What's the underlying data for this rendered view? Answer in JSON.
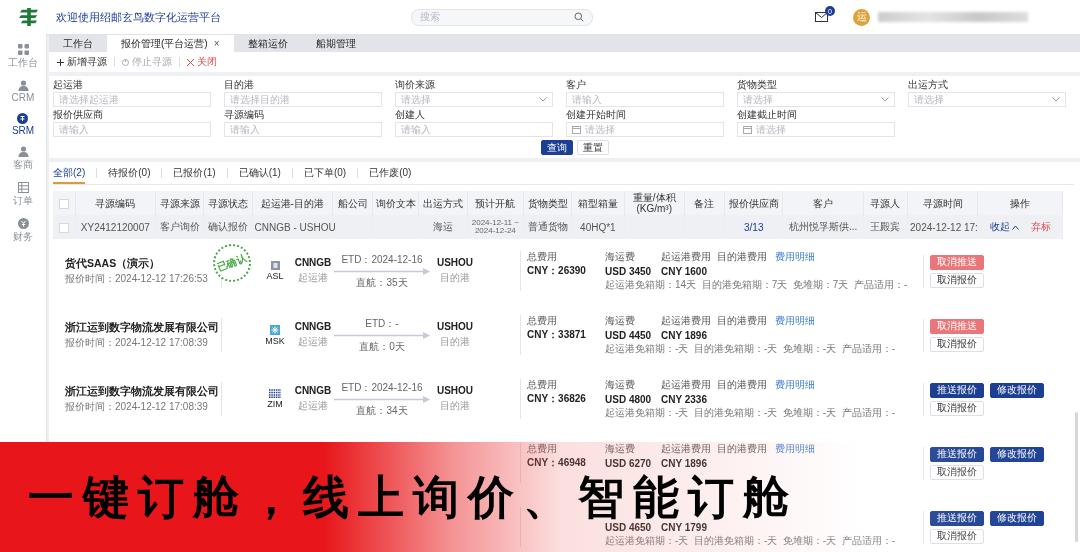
{
  "header": {
    "title": "欢迎使用绍邮玄鸟数字化运营平台",
    "search": {
      "placeholder": "搜索"
    },
    "mail_badge": "0",
    "avatar": "运"
  },
  "sidebar": {
    "items": [
      {
        "label": "工作台",
        "selected": false
      },
      {
        "label": "CRM",
        "selected": false
      },
      {
        "label": "SRM",
        "selected": true
      },
      {
        "label": "客商",
        "selected": false
      },
      {
        "label": "订单",
        "selected": false
      },
      {
        "label": "财务",
        "selected": false
      }
    ]
  },
  "tabs": [
    {
      "label": "工作台",
      "selected": false
    },
    {
      "label": "报价管理(平台运营)",
      "selected": true,
      "close": "×"
    },
    {
      "label": "整箱运价",
      "selected": false
    },
    {
      "label": "船期管理",
      "selected": false
    }
  ],
  "toolbar": [
    {
      "kind": "add",
      "label": "新增寻源",
      "disabled": false
    },
    {
      "kind": "stop",
      "label": "停止寻源",
      "disabled": true
    },
    {
      "kind": "close",
      "label": "关闭",
      "disabled": false
    }
  ],
  "filters": [
    {
      "label": "起运港",
      "kind": "text",
      "placeholder": "请选择起运港"
    },
    {
      "label": "目的港",
      "kind": "text",
      "placeholder": "请选择目的港"
    },
    {
      "label": "询价来源",
      "kind": "select",
      "placeholder": "请选择"
    },
    {
      "label": "客户",
      "kind": "text",
      "placeholder": "请输入"
    },
    {
      "label": "货物类型",
      "kind": "select",
      "placeholder": "请选择"
    },
    {
      "label": "出运方式",
      "kind": "select",
      "placeholder": "请选择"
    },
    {
      "label": "报价供应商",
      "kind": "text",
      "placeholder": "请输入"
    },
    {
      "label": "寻源编码",
      "kind": "text",
      "placeholder": "请输入"
    },
    {
      "label": "创建人",
      "kind": "text",
      "placeholder": "请输入"
    },
    {
      "label": "创建开始时间",
      "kind": "date",
      "placeholder": "请选择"
    },
    {
      "label": "创建截止时间",
      "kind": "date",
      "placeholder": "请选择"
    }
  ],
  "filter_buttons": [
    {
      "label": "查询",
      "kind": "primary"
    },
    {
      "label": "重置",
      "kind": "plain"
    }
  ],
  "status_tabs": [
    {
      "label": "全部(2)",
      "selected": true
    },
    {
      "label": "待报价(0)",
      "selected": false
    },
    {
      "label": "已报价(1)",
      "selected": false
    },
    {
      "label": "已确认(1)",
      "selected": false
    },
    {
      "label": "已下单(0)",
      "selected": false
    },
    {
      "label": "已作废(0)",
      "selected": false
    }
  ],
  "table": {
    "all_checked": false,
    "columns": [
      "寻源编码",
      "寻源来源",
      "寻源状态",
      "起运港-目的港",
      "船公司",
      "询价文本",
      "出运方式",
      "预计开航",
      "货物类型",
      "箱型箱量",
      "重量/体积(KG/m³)",
      "备注",
      "报价供应商",
      "客户",
      "寻源人",
      "寻源时间",
      "操作"
    ],
    "rows": [
      {
        "checked": false,
        "expanded": true,
        "cells": [
          "XY2412120007",
          "客户询价",
          "确认报价",
          "CNNGB - USHOU",
          null,
          null,
          "海运",
          "2024-12-11 ~ 2024-12-24",
          "普通货物",
          "40HQ*1",
          null,
          null,
          "3/13",
          "杭州悦孚斯供...",
          "王殿宾",
          "2024-12-12 17:"
        ],
        "actions": [
          {
            "label": "收起",
            "kind": "collapse"
          },
          {
            "label": "弃标",
            "kind": "danger"
          }
        ]
      }
    ]
  },
  "quotes": [
    {
      "company": "货代SAAS（演示）",
      "time": "报价时间：2024-12-12 17:26:53",
      "stamp": "已确认",
      "carrier": "ASL",
      "origin": "CNNGB",
      "origin_label": "起运港",
      "etd": "ETD：2024-12-16",
      "transit": "直航：35天",
      "dest": "USHOU",
      "dest_label": "目的港",
      "total_label": "总费用",
      "total": "CNY：26390",
      "fee_labels": [
        "海运费",
        "起运港费用",
        "目的港费用"
      ],
      "fee_values": [
        "USD 3450",
        "CNY 1600"
      ],
      "detail_link": "费用明细",
      "terms": "起运港免箱期：14天  目的港免箱期：7天  免堆期：7天  产品适用：-",
      "action_rows": [
        [
          {
            "label": "取消推送",
            "kind": "danger"
          }
        ],
        [
          {
            "label": "取消报价",
            "kind": "plain"
          }
        ]
      ]
    },
    {
      "company": "浙江运到数字物流发展有限公司",
      "time": "报价时间：2024-12-12 17:08:39",
      "carrier": "MSK",
      "origin": "CNNGB",
      "origin_label": "起运港",
      "etd": "ETD：-",
      "transit": "直航：0天",
      "dest": "USHOU",
      "dest_label": "目的港",
      "total_label": "总费用",
      "total": "CNY：33871",
      "fee_labels": [
        "海运费",
        "起运港费用",
        "目的港费用"
      ],
      "fee_values": [
        "USD 4450",
        "CNY 1896"
      ],
      "detail_link": "费用明细",
      "terms": "起运港免箱期：-天  目的港免箱期：-天  免堆期：-天  产品适用：-",
      "action_rows": [
        [
          {
            "label": "取消推送",
            "kind": "danger"
          }
        ],
        [
          {
            "label": "取消报价",
            "kind": "plain"
          }
        ]
      ]
    },
    {
      "company": "浙江运到数字物流发展有限公司",
      "time": "报价时间：2024-12-12 17:08:39",
      "carrier": "ZIM",
      "origin": "CNNGB",
      "origin_label": "起运港",
      "etd": "ETD：2024-12-16",
      "transit": "直航：34天",
      "dest": "USHOU",
      "dest_label": "目的港",
      "total_label": "总费用",
      "total": "CNY：36826",
      "fee_labels": [
        "海运费",
        "起运港费用",
        "目的港费用"
      ],
      "fee_values": [
        "USD 4800",
        "CNY 2336"
      ],
      "detail_link": "费用明细",
      "terms": "起运港免箱期：-天  目的港免箱期：-天  免堆期：-天  产品适用：-",
      "action_rows": [
        [
          {
            "label": "推送报价",
            "kind": "primary"
          },
          {
            "label": "修改报价",
            "kind": "primary"
          }
        ],
        [
          {
            "label": "取消报价",
            "kind": "plain"
          }
        ]
      ]
    },
    {
      "total_label": "总费用",
      "total": "CNY：46948",
      "fee_labels": [
        "海运费",
        "起运港费用",
        "目的港费用"
      ],
      "fee_values": [
        "USD 6270",
        "CNY 1896"
      ],
      "detail_link": "费用明细",
      "action_rows": [
        [
          {
            "label": "推送报价",
            "kind": "primary"
          },
          {
            "label": "修改报价",
            "kind": "primary"
          }
        ],
        [
          {
            "label": "取消报价",
            "kind": "plain"
          }
        ]
      ]
    },
    {
      "fee_values": [
        "USD 4650",
        "CNY 1799"
      ],
      "terms": "起运港免箱期：-天  目的港免箱期：-天  免堆期：-天  产品适用：-",
      "action_rows": [
        [
          {
            "label": "推送报价",
            "kind": "primary"
          },
          {
            "label": "修改报价",
            "kind": "primary"
          }
        ],
        [
          {
            "label": "取消报价",
            "kind": "plain"
          }
        ]
      ]
    }
  ],
  "banner": {
    "slogan": "一键订舱，线上询价、智能订舱"
  }
}
